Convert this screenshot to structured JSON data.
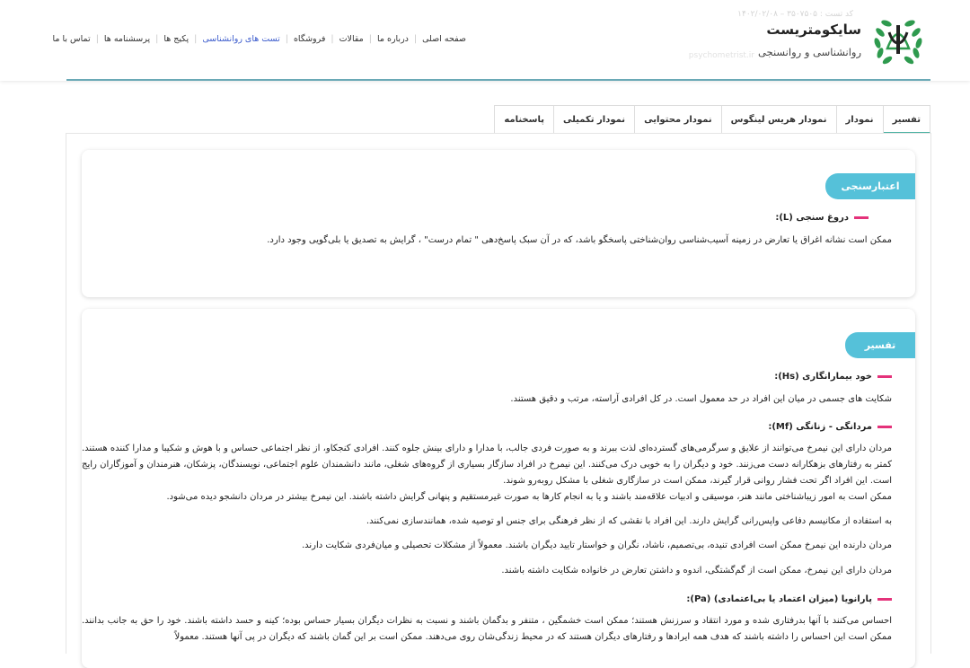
{
  "header": {
    "brand_name": "سایکومتریست",
    "brand_sub": "روانشناسی و روانسنجی",
    "faded_date": "کد تست : ۳۵۰۷۵۰۵ – ۱۴۰۲/۰۲/۰۸",
    "faded_text": "psychometrist.ir",
    "nav": [
      "صفحه اصلی",
      "درباره ما",
      "مقالات",
      "فروشگاه",
      "تست های روانشناسی",
      "پکیج ها",
      "پرسشنامه ها",
      "تماس با ما"
    ],
    "nav_active_index": 4,
    "accent": "#3b5bcc"
  },
  "tabs": [
    "تفسیر",
    "نمودار",
    "نمودار هریس لینگوس",
    "نمودار محتوایی",
    "نمودار تکمیلی",
    "پاسخنامه"
  ],
  "tab_active_index": 0,
  "colors": {
    "pill": "#55c1d9",
    "dash": "#e4327a",
    "tab_underline": "#4fb3a4",
    "header_line": "#6aa9b6"
  },
  "section1": {
    "title": "اعتبارسنجی",
    "items": [
      {
        "heading": "دروغ سنجی (L):",
        "paragraphs": [
          "ممکن است نشانه اغراق یا تعارض در زمینه آسیب‌شناسی روان‌شناختی پاسخگو باشد، که در آن سبک پاسخ‌دهی \" تمام درست\" ، گرایش به تصدیق یا بلی‌گویی وجود دارد."
        ]
      }
    ]
  },
  "section2": {
    "title": "تفسیر",
    "items": [
      {
        "heading": "خود بیمارانگاری (Hs):",
        "paragraphs": [
          "شکایت های جسمی در میان این افراد در حد معمول است. در کل افرادی آراسته، مرتب و دقیق هستند."
        ]
      },
      {
        "heading": "مردانگی - زنانگی (Mf):",
        "paragraphs": [
          "مردان دارای این نیمرخ می‌توانند از علایق و سرگرمی‌های گسترده‌ای لذت ببرند و به صورت فردی جالب، با مدارا و دارای بینش جلوه کنند. افرادی کنجکاو، از نظر اجتماعی حساس و با هوش و شکیبا و مدارا کننده هستند. کمتر به رفتارهای بزهکارانه دست می‌زنند. خود و دیگران را به خوبی درک می‌کنند. این نیمرخ در افراد سازگار بسیاری از گروه‌های شغلی، مانند دانشمندان علوم اجتماعی، نویسندگان، پزشکان، هنرمندان و آموزگاران رایج است. این افراد اگر تحت فشار روانی قرار گیرند، ممکن است در سازگاری شغلی با مشکل روبه‌رو شوند.",
          "ممکن است به امور زیباشناختی مانند هنر، موسیقی و ادبیات علاقه‌مند باشند و یا به انجام کارها به صورت غیرمستقیم و پنهانی گرایش داشته باشند. این نیمرخ بیشتر در مردان دانشجو دیده می‌شود.",
          "به استفاده از مکانیسم دفاعی واپس‌رانی گرایش دارند. این افراد با نقشی که از نظر فرهنگی برای جنس او توصیه شده، همانندسازی نمی‌کنند.",
          "مردان دارنده این نیمرخ ممکن است افرادی تنیده، بی‌تصمیم، ناشاد، نگران و خواستار تایید دیگران باشند. معمولاً از مشکلات تحصیلی و میان‌فردی شکایت دارند.",
          "مردان دارای این نیمرخ، ممکن است از گم‌گشتگی، اندوه و داشتن تعارض در خانواده شکایت داشته باشند."
        ]
      },
      {
        "heading": "پارانویا (میزان اعتماد یا بی‌اعتمادی) (Pa):",
        "paragraphs": [
          "احساس می‌کنند با آنها بدرفتاری شده و مورد انتقاد و سرزنش هستند؛ ممکن است خشمگین ، متنفر و بدگمان باشند و نسبت به نظرات دیگران بسیار حساس بوده؛ کینه و حسد داشته باشند. خود را حق به جانب بدانند. ممکن است این احساس را داشته باشند که هدف همه ایرادها و رفتارهای دیگران هستند که در محیط زندگی‌شان روی می‌دهند. ممکن است بر این گمان باشند که دیگران در پی آنها هستند. معمولاً"
        ]
      }
    ]
  }
}
